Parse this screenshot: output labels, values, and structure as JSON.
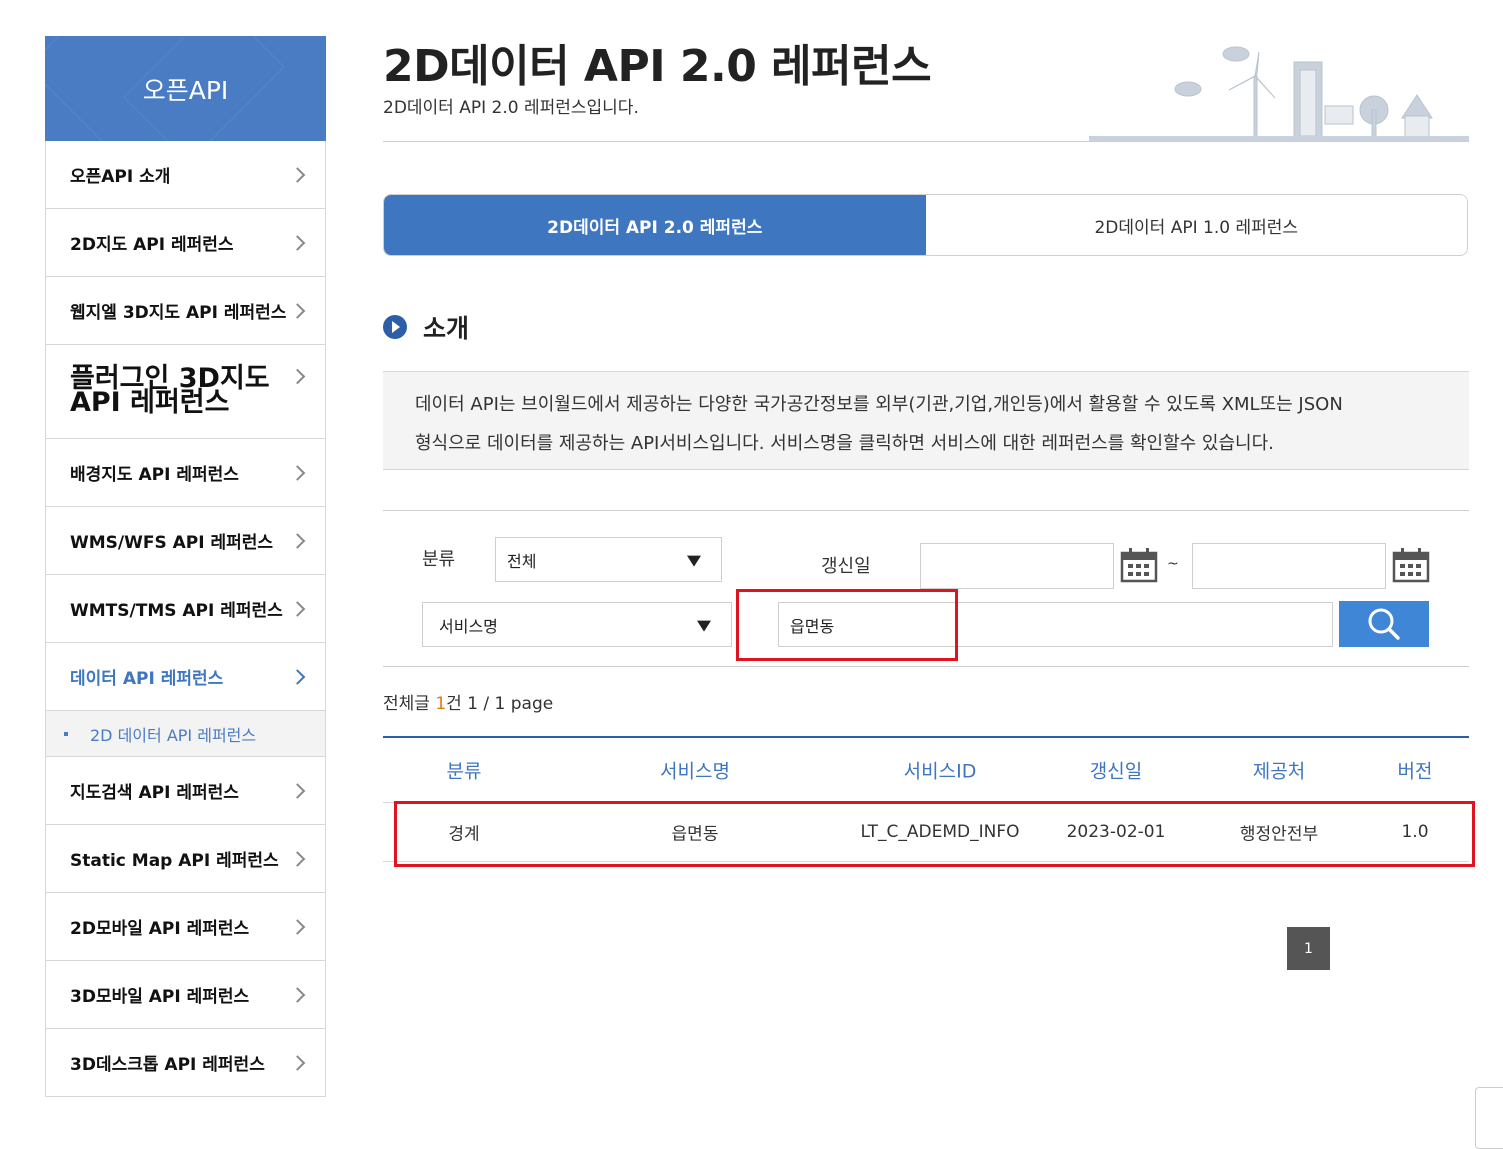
{
  "sidebar": {
    "title": "오픈API",
    "items": [
      {
        "label": "오픈API 소개"
      },
      {
        "label": "2D지도 API 레퍼런스"
      },
      {
        "label": "웹지엘 3D지도 API 레퍼런스"
      },
      {
        "label": "플러그인 3D지도 API 레퍼런스"
      },
      {
        "label": "배경지도 API 레퍼런스"
      },
      {
        "label": "WMS/WFS API 레퍼런스"
      },
      {
        "label": "WMTS/TMS API 레퍼런스"
      },
      {
        "label": "데이터 API 레퍼런스"
      },
      {
        "label": "지도검색 API 레퍼런스"
      },
      {
        "label": "Static Map API 레퍼런스"
      },
      {
        "label": "2D모바일 API 레퍼런스"
      },
      {
        "label": "3D모바일 API 레퍼런스"
      },
      {
        "label": "3D데스크톱 API 레퍼런스"
      }
    ],
    "sub_item": "2D 데이터 API 레퍼런스",
    "active_index": 7
  },
  "page": {
    "title": "2D데이터 API 2.0 레퍼런스",
    "subtitle": "2D데이터 API 2.0 레퍼런스입니다."
  },
  "tabs": [
    {
      "label": "2D데이터 API 2.0 레퍼런스",
      "active": true
    },
    {
      "label": "2D데이터 API 1.0 레퍼런스",
      "active": false
    }
  ],
  "section": {
    "title": "소개",
    "intro_line1": "데이터 API는 브이월드에서 제공하는 다양한 국가공간정보를 외부(기관,기업,개인등)에서 활용할 수 있도록 XML또는 JSON",
    "intro_line2": "형식으로 데이터를 제공하는 API서비스입니다. 서비스명을 클릭하면 서비스에 대한 레퍼런스를 확인할수 있습니다."
  },
  "search": {
    "category_label": "분류",
    "category_value": "전체",
    "date_label": "갱신일",
    "date_from": "",
    "date_to": "",
    "date_sep": "~",
    "field_select": "서비스명",
    "keyword": "읍면동"
  },
  "result": {
    "prefix": "전체글 ",
    "count": "1",
    "suffix": "건 1 / 1 page"
  },
  "table": {
    "headers": [
      "분류",
      "서비스명",
      "서비스ID",
      "갱신일",
      "제공처",
      "버전"
    ],
    "rows": [
      [
        "경계",
        "읍면동",
        "LT_C_ADEMD_INFO",
        "2023-02-01",
        "행정안전부",
        "1.0"
      ]
    ]
  },
  "pagination": {
    "current": "1"
  },
  "colors": {
    "accent": "#3f76c0",
    "sidebar_header": "#4a7cc4",
    "highlight": "#e0141e",
    "count": "#e37b14"
  }
}
